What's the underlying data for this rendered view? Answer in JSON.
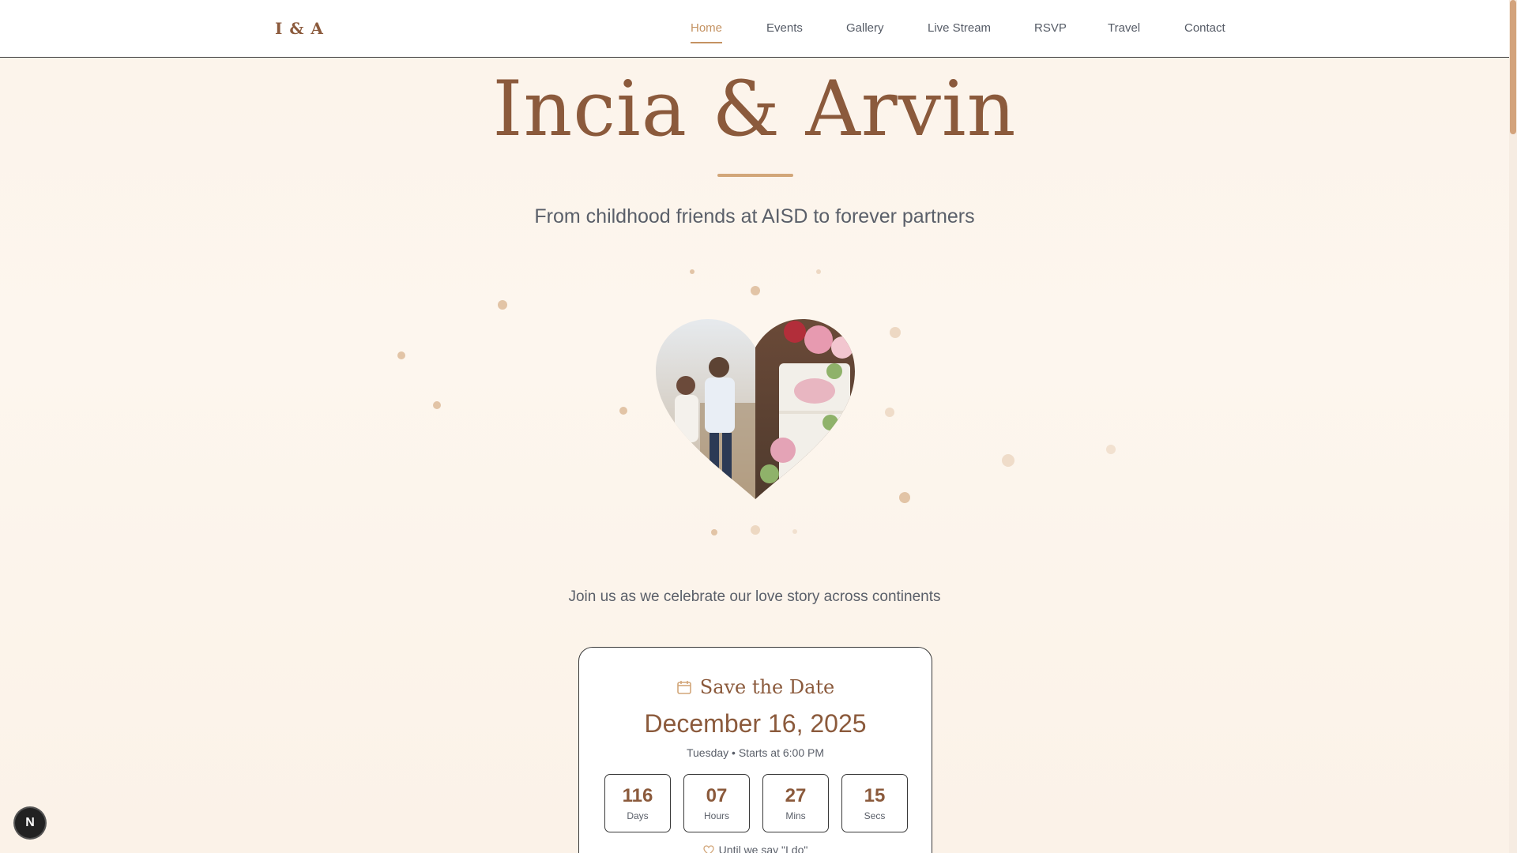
{
  "nav": {
    "logo": "I & A",
    "items": [
      {
        "label": "Home",
        "active": true
      },
      {
        "label": "Events"
      },
      {
        "label": "Gallery"
      },
      {
        "label": "Live Stream"
      },
      {
        "label": "RSVP"
      },
      {
        "label": "Travel"
      },
      {
        "label": "Contact"
      }
    ]
  },
  "hero": {
    "title": "Incia & Arvin",
    "tagline": "From childhood friends at AISD to forever partners",
    "invite": "Join us as we celebrate our love story across continents"
  },
  "save_the_date": {
    "heading": "Save the Date",
    "date": "December 16, 2025",
    "details": "Tuesday • Starts at 6:00 PM",
    "countdown": [
      {
        "value": "116",
        "label": "Days"
      },
      {
        "value": "07",
        "label": "Hours"
      },
      {
        "value": "27",
        "label": "Mins"
      },
      {
        "value": "15",
        "label": "Secs"
      }
    ],
    "footer": "Until we say \"I do\""
  },
  "badge": {
    "letter": "N"
  },
  "colors": {
    "accent": "#c49262",
    "brown": "#8b5a3c",
    "background": "#fdf6ee"
  }
}
